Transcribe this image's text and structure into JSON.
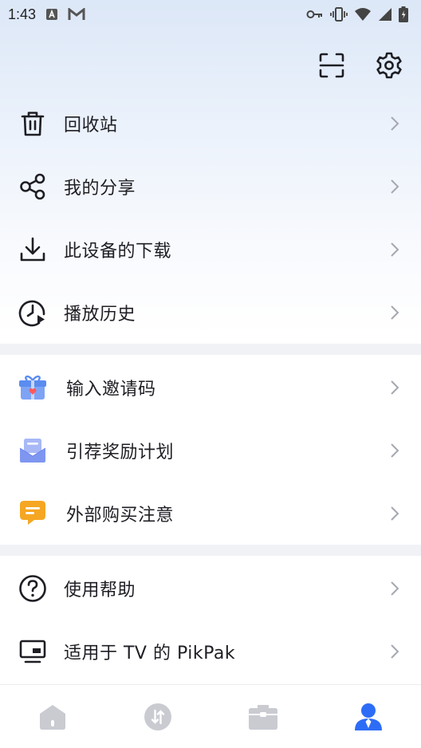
{
  "status_bar": {
    "time": "1:43",
    "notification_icons": [
      "a-icon",
      "gmail-icon"
    ],
    "system_icons": [
      "key-icon",
      "vibrate-icon",
      "wifi-icon",
      "signal-icon",
      "battery-icon"
    ]
  },
  "top_actions": [
    "scan-icon",
    "settings-icon"
  ],
  "section1": [
    {
      "label": "回收站",
      "icon": "trash-icon"
    },
    {
      "label": "我的分享",
      "icon": "share-icon"
    },
    {
      "label": "此设备的下载",
      "icon": "download-icon"
    },
    {
      "label": "播放历史",
      "icon": "history-icon"
    }
  ],
  "section2": [
    {
      "label": "输入邀请码",
      "icon": "gift-icon"
    },
    {
      "label": "引荐奖励计划",
      "icon": "envelope-icon"
    },
    {
      "label": "外部购买注意",
      "icon": "message-icon"
    }
  ],
  "section3": [
    {
      "label": "使用帮助",
      "icon": "help-icon"
    },
    {
      "label": "适用于 TV 的 PikPak",
      "icon": "tv-icon"
    }
  ],
  "bottom_nav": {
    "tabs": [
      "home-icon",
      "transfer-icon",
      "box-icon",
      "profile-icon"
    ],
    "active": "profile-icon"
  },
  "colors": {
    "accent": "#2d6df6",
    "inactive_tab": "#c9cbd1",
    "gift": "#5b8cf0",
    "envelope": "#7f96f1",
    "message": "#f5a623"
  }
}
